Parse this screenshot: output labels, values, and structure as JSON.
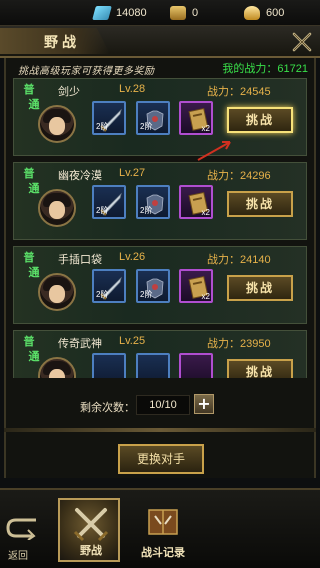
{
  "currency": {
    "diamond": "14080",
    "token": "0",
    "gold": "600"
  },
  "header": {
    "title": "野战"
  },
  "tip": "挑战高级玩家可获得更多奖励",
  "my_power": "我的战力：61721",
  "opponents": [
    {
      "rank_top": "普",
      "rank_bottom": "通",
      "name": "剑少",
      "level": "Lv.28",
      "power": "战力：24545",
      "slots": [
        "2阶",
        "2阶",
        "x2"
      ],
      "button": "挑战",
      "highlight": true
    },
    {
      "rank_top": "普",
      "rank_bottom": "通",
      "name": "幽夜冷漠",
      "level": "Lv.27",
      "power": "战力：24296",
      "slots": [
        "2阶",
        "2阶",
        "x2"
      ],
      "button": "挑战",
      "highlight": false
    },
    {
      "rank_top": "普",
      "rank_bottom": "通",
      "name": "手插口袋",
      "level": "Lv.26",
      "power": "战力：24140",
      "slots": [
        "2阶",
        "2阶",
        "x2"
      ],
      "button": "挑战",
      "highlight": false
    },
    {
      "rank_top": "普",
      "rank_bottom": "通",
      "name": "传奇武神",
      "level": "Lv.25",
      "power": "战力：23950",
      "slots": [
        "",
        "",
        ""
      ],
      "button": "挑战",
      "highlight": false
    }
  ],
  "remain": {
    "label": "剩余次数：",
    "value": "10/10"
  },
  "refresh_label": "更换对手",
  "nav": {
    "back": "返回",
    "tab_field": "野战",
    "tab_record": "战斗记录"
  },
  "colors": {
    "accent_gold": "#c8a14a",
    "power_green": "#39e04a",
    "rank_green": "#5ce36a",
    "level_orange": "#e7b24a"
  }
}
